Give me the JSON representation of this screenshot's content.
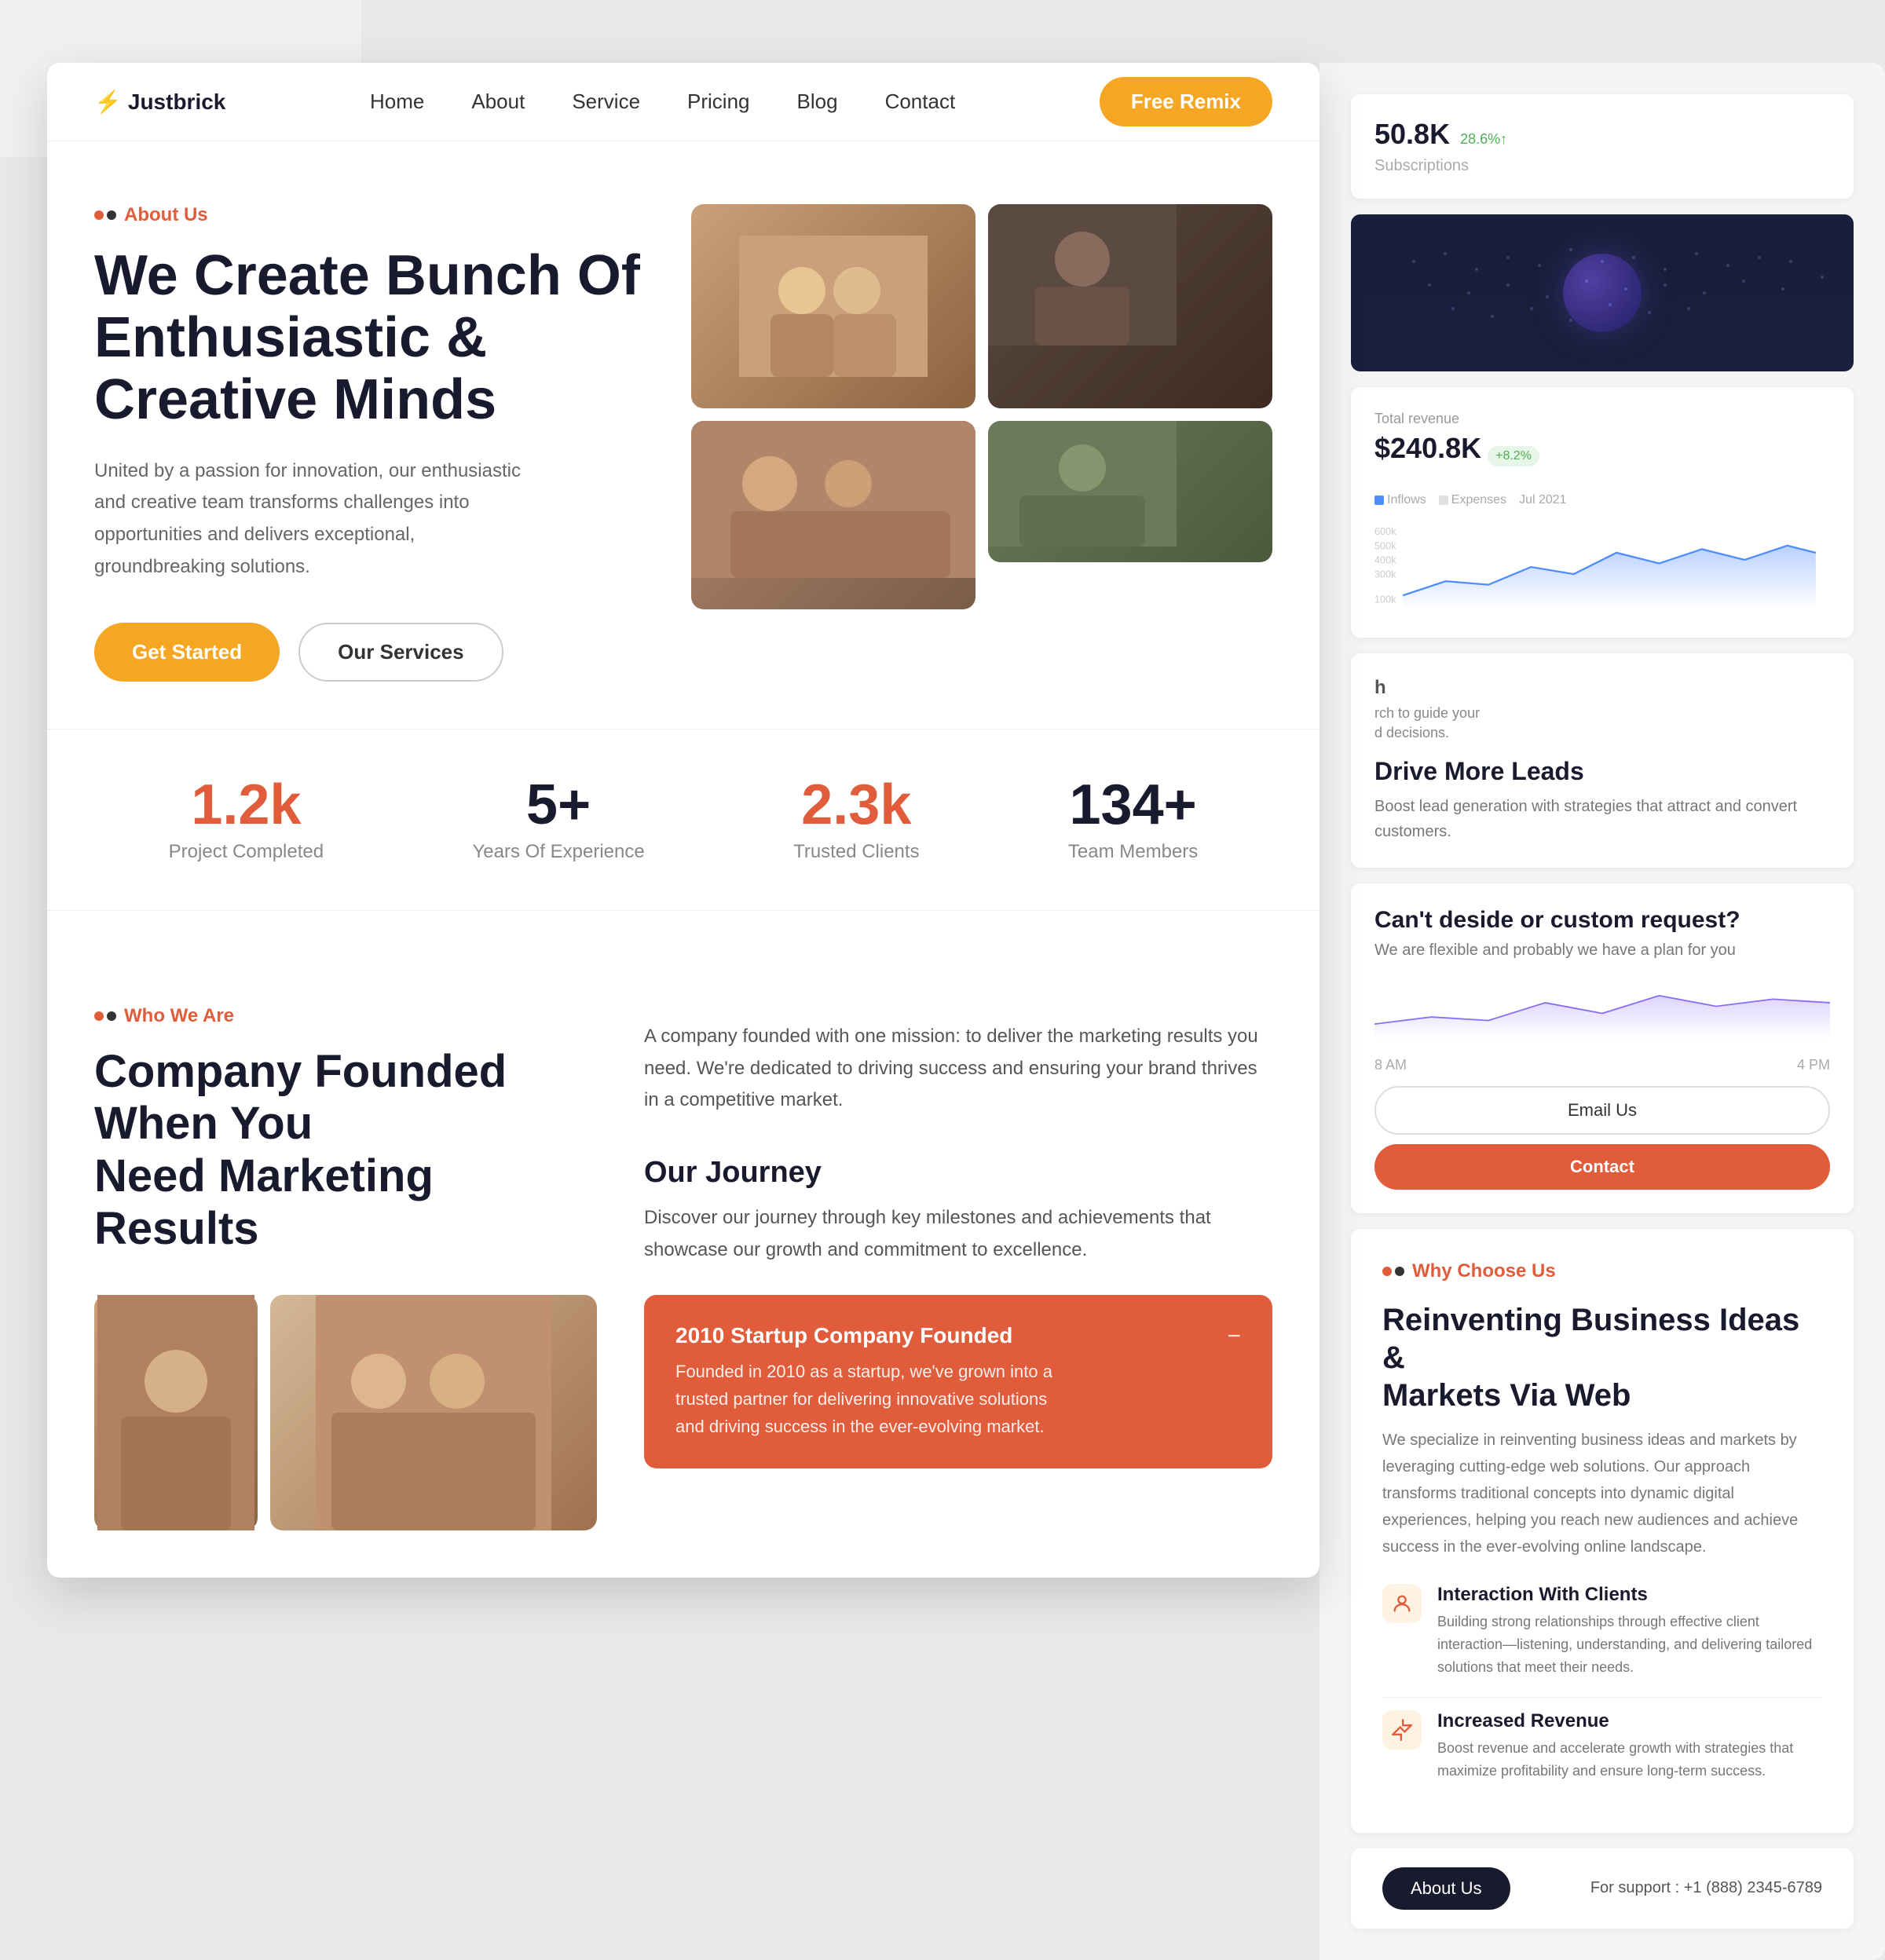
{
  "brand": {
    "name": "Justbrick",
    "logo_symbol": "▲"
  },
  "navbar": {
    "links": [
      {
        "label": "Home",
        "id": "home"
      },
      {
        "label": "About",
        "id": "about"
      },
      {
        "label": "Service",
        "id": "service"
      },
      {
        "label": "Pricing",
        "id": "pricing"
      },
      {
        "label": "Blog",
        "id": "blog"
      },
      {
        "label": "Contact",
        "id": "contact"
      }
    ],
    "cta_label": "Free Remix"
  },
  "hero": {
    "section_label": "About Us",
    "title_line1": "We Create Bunch Of",
    "title_line2": "Enthusiastic &",
    "title_line3": "Creative Minds",
    "description": "United by a passion for innovation, our enthusiastic and creative team transforms challenges into opportunities and delivers exceptional, groundbreaking solutions.",
    "btn_primary": "Get Started",
    "btn_secondary": "Our Services"
  },
  "stats": [
    {
      "number": "1.2k",
      "label": "Project Completed",
      "accent": true
    },
    {
      "number": "5+",
      "label": "Years Of Experience",
      "accent": false
    },
    {
      "number": "2.3k",
      "label": "Trusted Clients",
      "accent": true
    },
    {
      "number": "134+",
      "label": "Team Members",
      "accent": false
    }
  ],
  "who_section": {
    "section_label": "Who We Are",
    "title_line1": "Company Founded When You",
    "title_line2": "Need Marketing Results",
    "description": "A company founded with one mission: to deliver the marketing results you need. We're dedicated to driving success and ensuring your brand thrives in a competitive market.",
    "journey_title": "Our Journey",
    "journey_desc": "Discover our journey through key milestones and achievements that showcase our growth and commitment to excellence.",
    "card_year": "2010 Startup Company Founded",
    "card_text": "Founded in 2010 as a startup, we've grown into a trusted partner for delivering innovative solutions and driving success in the ever-evolving market.",
    "card_icon": "−"
  },
  "right_panel": {
    "stats_number": "50.8K",
    "stats_badge": "28.6%↑",
    "subscriptions_label": "Subscriptions",
    "revenue_label": "Total revenue",
    "revenue_amount": "$240.8K",
    "revenue_badge": "+8.2%",
    "chart_legend": [
      "Inflows",
      "Expenses",
      "Jul 2021"
    ],
    "chart_y_labels": [
      "600k",
      "500k",
      "400k",
      "300k",
      "100k"
    ],
    "leads_title": "Drive More Leads",
    "leads_text": "Boost lead generation with strategies that attract and convert customers.",
    "search_partial": "h",
    "search_desc1": "rch to guide your",
    "search_desc2": "d decisions.",
    "custom_title": "Can't deside or custom request?",
    "custom_text": "We are flexible and probably we have a plan for you",
    "time_labels": [
      "8 AM",
      "4 PM"
    ],
    "btn_email": "Email Us",
    "btn_contact": "Contact",
    "why_label": "Why Choose Us",
    "why_title_line1": "Reinventing Business Ideas &",
    "why_title_line2": "Markets Via Web",
    "why_text": "We specialize in reinventing business ideas and markets by leveraging cutting-edge web solutions. Our approach transforms traditional concepts into dynamic digital experiences, helping you reach new audiences and achieve success in the ever-evolving online landscape.",
    "features": [
      {
        "title": "Interaction With Clients",
        "text": "Building strong relationships through effective client interaction—listening, understanding, and delivering tailored solutions that meet their needs."
      },
      {
        "title": "Increased Revenue",
        "text": "Boost revenue and accelerate growth with strategies that maximize profitability and ensure long-term success."
      }
    ],
    "btn_about_us": "About Us",
    "support_text": "For support : +1 (888) 2345-6789"
  }
}
